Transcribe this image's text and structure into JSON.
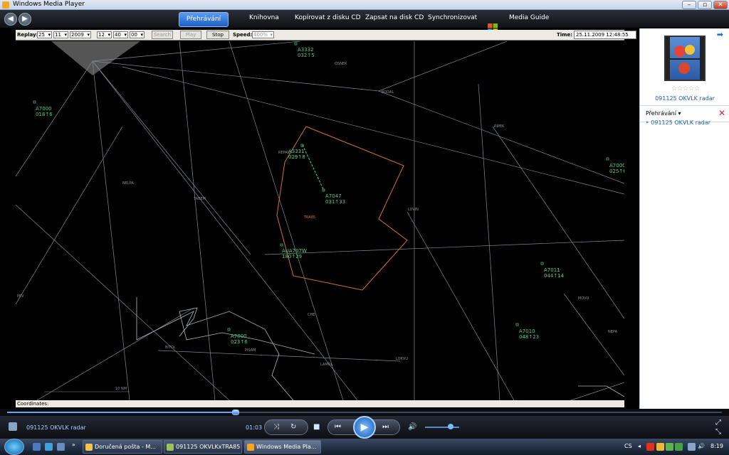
{
  "window": {
    "title": "Windows Media Player"
  },
  "nav": {
    "tabs": [
      "Přehrávání",
      "Knihovna",
      "Kopírovat z disku CD",
      "Zapsat na disk CD",
      "Synchronizovat",
      "Media Guide"
    ],
    "active_tab": "Přehrávání"
  },
  "controls": {
    "replay_label": "Replay:",
    "day": "25",
    "month": "11",
    "year": "2009",
    "hour": "12",
    "minute": "40",
    "second": "00",
    "search_label": "Search",
    "play_label": "Play",
    "stop_label": "Stop",
    "speed_label": "Speed:",
    "speed_value": "400%",
    "time_label": "Time:",
    "time_value": "25.11.2009 12:48:55"
  },
  "radar": {
    "coordinates_label": "Coordinates:",
    "sector_label": "TRA85",
    "scale_label": "10 NM",
    "aircraft": [
      {
        "code": "A3332",
        "alt": "032↑5"
      },
      {
        "code": "A7000",
        "alt": "018↑6"
      },
      {
        "code": "A3331",
        "alt": "029↑8"
      },
      {
        "code": "A7047",
        "alt": "031↑33"
      },
      {
        "code": "AUA707W",
        "alt": "180↑29"
      },
      {
        "code": "A7000",
        "alt": "025↑6"
      },
      {
        "code": "A7011",
        "alt": "044↑14"
      },
      {
        "code": "A7010",
        "alt": "048↑23"
      },
      {
        "code": "A7000",
        "alt": "023↑6"
      }
    ],
    "waypoints": [
      "OSNEK",
      "BODAL",
      "RIPEK",
      "NELPA",
      "TABEM",
      "LUVIN",
      "REPAL",
      "PEV",
      "CHE",
      "BITOL",
      "PISAM",
      "LAMOL",
      "LOKVU",
      "MOVU",
      "NEPA"
    ]
  },
  "sidebar": {
    "media_title": "091125 OKVLK radar",
    "list_header": "Přehrávání",
    "list_items": [
      "091125 OKVLK radar"
    ]
  },
  "player": {
    "now_playing": "091125 OKVLK radar",
    "elapsed": "01:03",
    "seek_fraction": 0.32,
    "volume_fraction": 0.75
  },
  "taskbar": {
    "items": [
      "Doručená pošta - M...",
      "091125 OKVLKxTRA85",
      "Windows Media Pla..."
    ],
    "active_index": 2,
    "language": "CS",
    "clock": "8:19"
  }
}
